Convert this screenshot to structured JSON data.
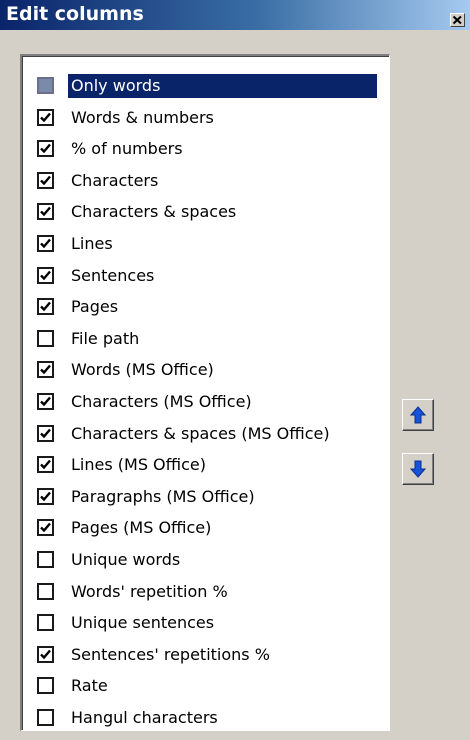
{
  "window": {
    "title": "Edit columns",
    "close_symbol": "×"
  },
  "colors": {
    "titlebar_start": "#0a246a",
    "titlebar_end": "#a6caf0",
    "selection": "#0a246a",
    "arrow_blue": "#1653d8"
  },
  "columns": [
    {
      "label": "Only words",
      "checked": false,
      "selected": true
    },
    {
      "label": "Words & numbers",
      "checked": true
    },
    {
      "label": "% of numbers",
      "checked": true
    },
    {
      "label": "Characters",
      "checked": true
    },
    {
      "label": "Characters & spaces",
      "checked": true
    },
    {
      "label": "Lines",
      "checked": true
    },
    {
      "label": "Sentences",
      "checked": true
    },
    {
      "label": "Pages",
      "checked": true
    },
    {
      "label": "File path",
      "checked": false
    },
    {
      "label": "Words (MS Office)",
      "checked": true
    },
    {
      "label": "Characters (MS Office)",
      "checked": true
    },
    {
      "label": "Characters & spaces (MS Office)",
      "checked": true
    },
    {
      "label": "Lines (MS Office)",
      "checked": true
    },
    {
      "label": "Paragraphs (MS Office)",
      "checked": true
    },
    {
      "label": "Pages (MS Office)",
      "checked": true
    },
    {
      "label": "Unique words",
      "checked": false
    },
    {
      "label": "Words' repetition %",
      "checked": false
    },
    {
      "label": "Unique sentences",
      "checked": false
    },
    {
      "label": "Sentences' repetitions %",
      "checked": true
    },
    {
      "label": "Rate",
      "checked": false
    },
    {
      "label": "Hangul characters",
      "checked": false
    }
  ],
  "buttons": {
    "move_up_icon": "arrow-up-icon",
    "move_down_icon": "arrow-down-icon"
  }
}
